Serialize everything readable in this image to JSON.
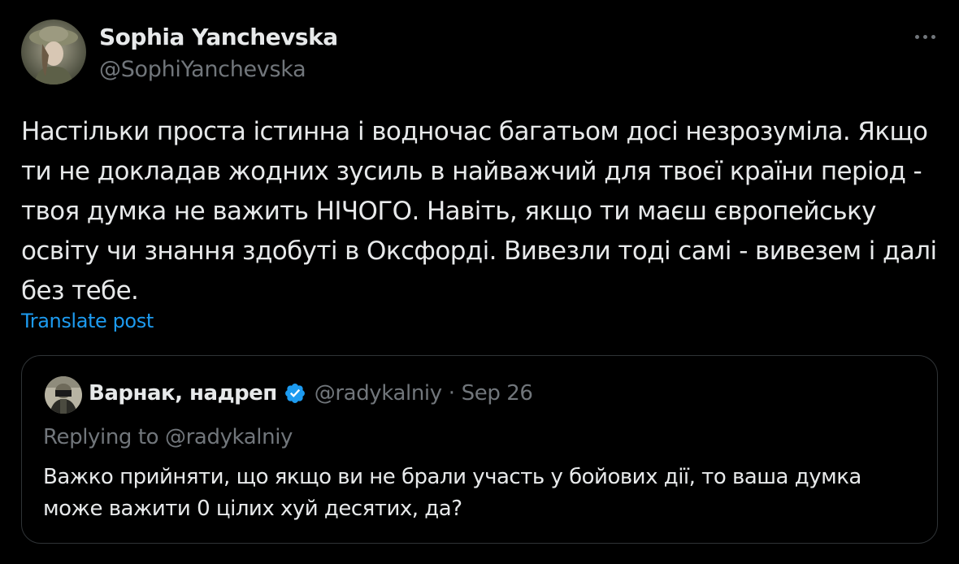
{
  "author": {
    "name": "Sophia Yanchevska",
    "handle": "@SophiYanchevska"
  },
  "tweet": {
    "text_lines": [
      "Настільки проста істинна і водночас багатьом досі незрозуміла. Якщо",
      "ти не докладав жодних зусиль в найважчий для твоєї країни період -",
      "твоя думка не важить НІЧОГО. Навіть, якщо ти маєш європейську",
      "освіту чи знання здобуті в Оксфорді. Вивезли тоді самі - вивезем і далі",
      "без тебе."
    ],
    "translate_label": "Translate post"
  },
  "quote": {
    "name": "Варнак, надреп",
    "handle": "@radykalniy",
    "separator": "·",
    "date": "Sep 26",
    "replying_to": "Replying to @radykalniy",
    "text_lines": [
      "Важко прийняти, що якщо ви не брали участь у бойових дії, то ваша думка",
      "може важити 0 цілих хуй десятих, да?"
    ]
  },
  "icons": {
    "more": "more-icon",
    "verified": "verified-badge-icon"
  },
  "colors": {
    "background": "#000000",
    "text": "#e7e9ea",
    "secondary": "#71767b",
    "link": "#1d9bf0",
    "border": "#2f3336",
    "verified": "#1d9bf0"
  }
}
